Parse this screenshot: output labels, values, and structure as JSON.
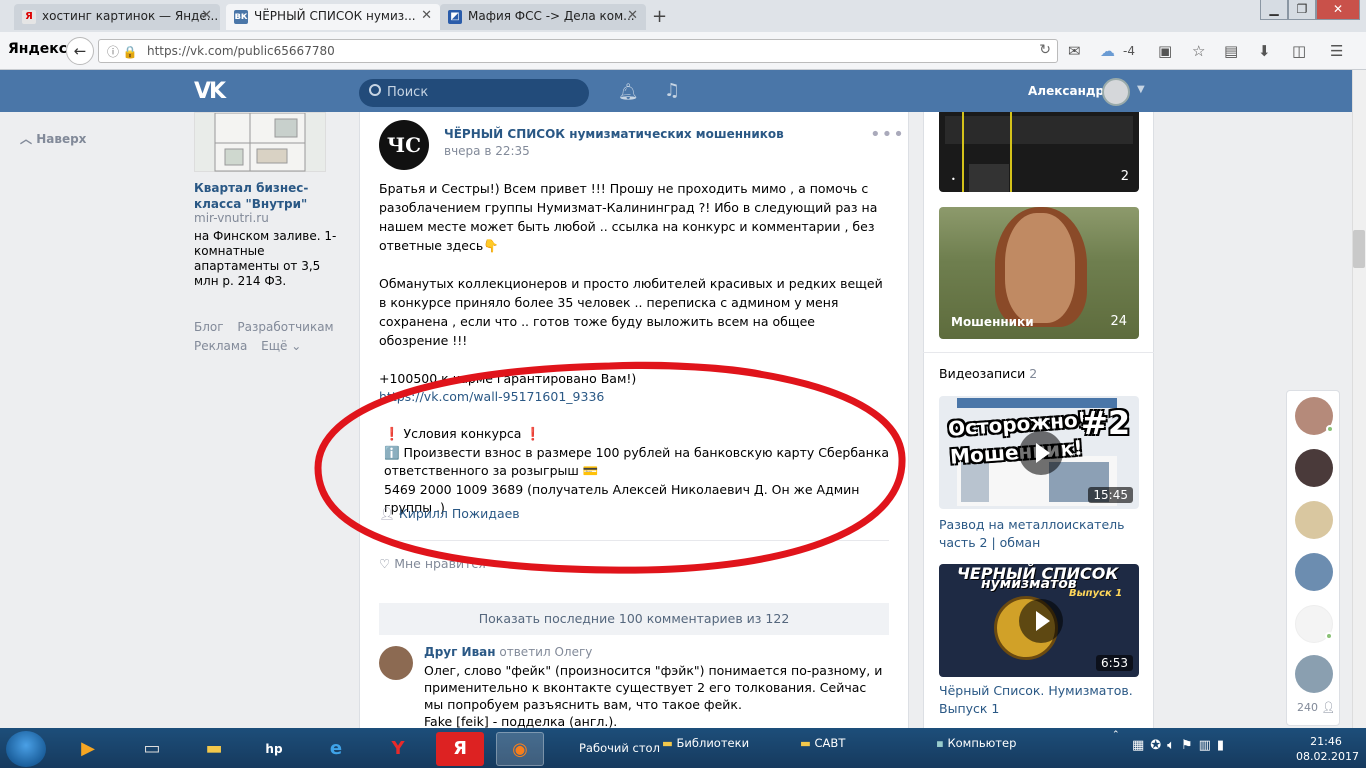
{
  "browser": {
    "tabs": [
      {
        "label": "хостинг картинок — Янде...",
        "icon": "Я",
        "icon_color": "#e5e5e5",
        "icon_text": "#d00"
      },
      {
        "label": "ЧЁРНЫЙ СПИСОК нумиз...",
        "icon": "вк",
        "icon_color": "#4a76a8",
        "icon_text": "#fff"
      },
      {
        "label": "Мафия ФСС -> Дела ком...",
        "icon": "◩",
        "icon_color": "#2a5caa",
        "icon_text": "#fff"
      }
    ],
    "new_tab": "+",
    "logo": "Яндекс",
    "url": "https://vk.com/public65667780",
    "cloud_temp": "-4"
  },
  "vk_header": {
    "logo": "VK",
    "search_placeholder": "Поиск",
    "user_name": "Александр",
    "accent": "#4a76a8"
  },
  "left": {
    "back_to_top": "Наверх",
    "ad": {
      "title": "Квартал бизнес-класса \"Внутри\"",
      "url": "mir-vnutri.ru",
      "desc": "на Финском заливе. 1-комнатные апартаменты от 3,5 млн р. 214 ФЗ."
    },
    "footer": [
      "Блог",
      "Разработчикам",
      "Реклама",
      "Ещё ⌄"
    ]
  },
  "post": {
    "avatar_text": "ЧС",
    "author": "ЧЁРНЫЙ СПИСОК нумизматических мошенников",
    "time": "вчера в 22:35",
    "paragraphs": [
      "Братья и Сестры!) Всем привет !!! Прошу не проходить мимо , а помочь с разоблачением группы Нумизмат-Калининград ?! Ибо в следующий раз на нашем месте может быть любой .. ссылка на конкурс и комментарии , без ответные здесь👇",
      "Обманутых коллекционеров и просто любителей красивых и редких вещей в конкурсе приняло более 35 человек .. переписка с админом у меня сохранена , если что .. готов тоже буду выложить всем на общее обозрение !!!",
      "+100500 к карме гарантировано Вам!)"
    ],
    "link": "https://vk.com/wall-95171601_9336",
    "conditions": [
      "❗ Условия конкурса ❗",
      "ℹ️ Произвести взнос в размере 100 рублей на банковскую карту Сбербанка ответственного за розыгрыш 💳",
      "5469 2000 1009 3689 (получатель Алексей Николаевич Д. Он же Админ группы .)"
    ],
    "signer": "Кирилл Пожидаев",
    "likes_cut": "Мне нравится",
    "show_comments": "Показать последние 100 комментариев из 122",
    "comment": {
      "author": "Друг Иван",
      "reply_to": "ответил Олегу",
      "text": "Олег, слово \"фейк\" (произносится \"фэйк\") понимается по-разному, и применительно к вконтакте существует 2 его толкования. Сейчас мы попробуем разъяснить вам, что такое фейк.",
      "text2": "Fake [feik] - подделка (англ.)."
    }
  },
  "right": {
    "album1_count": "2",
    "album2_label": "Мошенники",
    "album2_count": "24",
    "videos_label": "Видеозаписи",
    "videos_count": "2",
    "video1_overlay1": "Осторожно!",
    "video1_overlay2": "Мошенник!",
    "video1_num": "#2",
    "video1_duration": "15:45",
    "video1_title": "Развод на металлоискатель часть 2 | обман",
    "video2_t1": "ЧЕРНЫЙ СПИСОК",
    "video2_t2": "нумизматов",
    "video2_t3": "Выпуск 1",
    "video2_duration": "6:53",
    "video2_title": "Чёрный Список. Нумизматов. Выпуск 1"
  },
  "friends_count": "240",
  "taskbar": {
    "desktop": "Рабочий стол",
    "libraries": "Библиотеки",
    "savt": "САВТ",
    "computer": "Компьютер",
    "time": "21:46",
    "date": "08.02.2017"
  }
}
